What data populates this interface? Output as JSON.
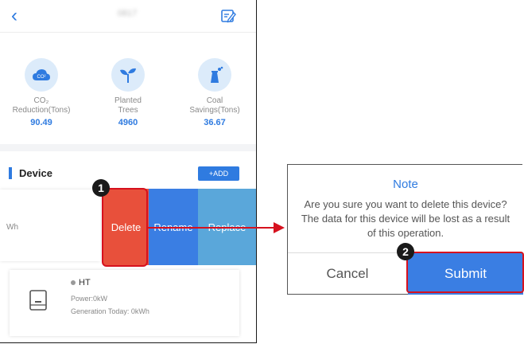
{
  "header": {
    "device_name": "0817"
  },
  "stats": [
    {
      "label_line1": "CO₂",
      "label_line2": "Reduction(Tons)",
      "value": "90.49"
    },
    {
      "label_line1": "Planted",
      "label_line2": "Trees",
      "value": "4960"
    },
    {
      "label_line1": "Coal",
      "label_line2": "Savings(Tons)",
      "value": "36.67"
    }
  ],
  "device_section": {
    "title": "Device",
    "add_label": "+ADD",
    "swiped_card_text": "Wh",
    "actions": {
      "delete": "Delete",
      "rename": "Rename",
      "replace": "Replace"
    },
    "card": {
      "name": "HT",
      "power": "Power:0kW",
      "generation": "Generation Today: 0kWh"
    }
  },
  "steps": {
    "step1": "1",
    "step2": "2"
  },
  "dialog": {
    "title": "Note",
    "message": "Are you sure you want to delete this device? The data for this device will be lost as a result of this operation.",
    "cancel": "Cancel",
    "submit": "Submit"
  },
  "colors": {
    "accent": "#2f7be0",
    "delete": "#e8503b",
    "rename": "#3a7ee3",
    "replace": "#5aa7da",
    "highlight": "#d6111e"
  },
  "icons": {
    "back": "chevron-left-icon",
    "edit": "edit-icon",
    "co2": "cloud-co2-icon",
    "tree": "sprout-icon",
    "coal": "factory-icon",
    "inverter": "inverter-icon"
  }
}
